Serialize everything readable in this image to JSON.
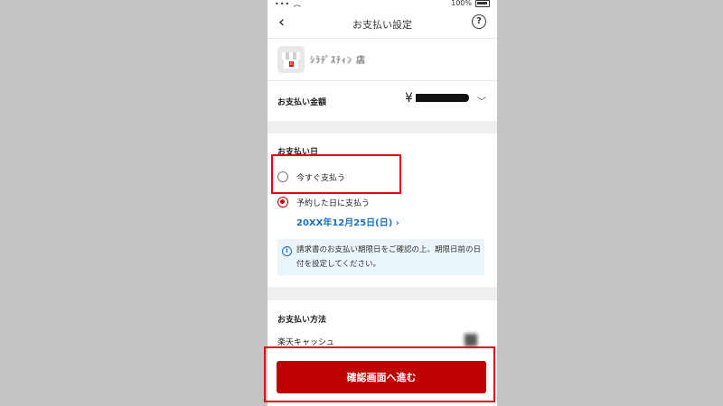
{
  "status_bar": {
    "battery_pct": "100%"
  },
  "nav": {
    "title": "お支払い設定",
    "back_glyph": "‹",
    "help_glyph": "?"
  },
  "merchant": {
    "name": "ｼﾗﾃﾞｽﾃｨﾝ 店"
  },
  "amount": {
    "label": "お支払い金額",
    "currency": "¥"
  },
  "payment_date": {
    "title": "お支払い日",
    "options": [
      {
        "label": "今すぐ支払う",
        "selected": false
      },
      {
        "label": "予約した日に支払う",
        "selected": true
      }
    ],
    "scheduled_date": "20XX年12月25日(日)",
    "info": "請求書のお支払い期限日をご確認の上、期限日前の日付を設定してください。"
  },
  "payment_method": {
    "title": "お支払い方法",
    "item": "楽天キャッシュ"
  },
  "footer": {
    "cta_label": "確認画面へ進む"
  },
  "colors": {
    "brand": "#bf0000",
    "link": "#1d6fb8",
    "highlight": "#e60012",
    "info_bg": "#eaf4fb"
  }
}
